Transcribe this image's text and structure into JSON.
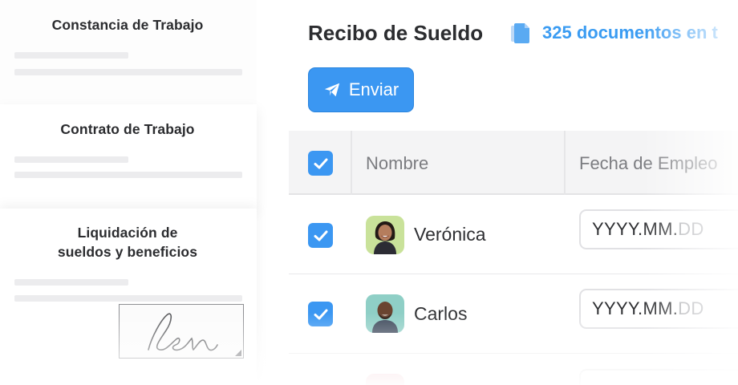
{
  "documents": [
    {
      "title": "Constancia de Trabajo"
    },
    {
      "title": "Contrato de Trabajo"
    },
    {
      "title_line1": "Liquidación de",
      "title_line2": "sueldos y beneficios"
    }
  ],
  "header": {
    "title": "Recibo de Sueldo",
    "doc_count": "325 documentos en t",
    "doc_icon": "document-stack-icon"
  },
  "toolbar": {
    "send_label": "Enviar",
    "send_icon": "paper-plane-icon"
  },
  "table": {
    "columns": [
      "Nombre",
      "Fecha de Empleo"
    ],
    "select_all_checked": true,
    "rows": [
      {
        "name": "Verónica",
        "checked": true,
        "date_typed": "YYYY.MM.",
        "date_placeholder": "DD"
      },
      {
        "name": "Carlos",
        "checked": true,
        "date_typed": "YYYY.MM.",
        "date_placeholder": "DD"
      }
    ]
  },
  "colors": {
    "accent": "#3b97f2",
    "count_text": "#3b9cf2",
    "header_bg": "#f4f4f5"
  }
}
